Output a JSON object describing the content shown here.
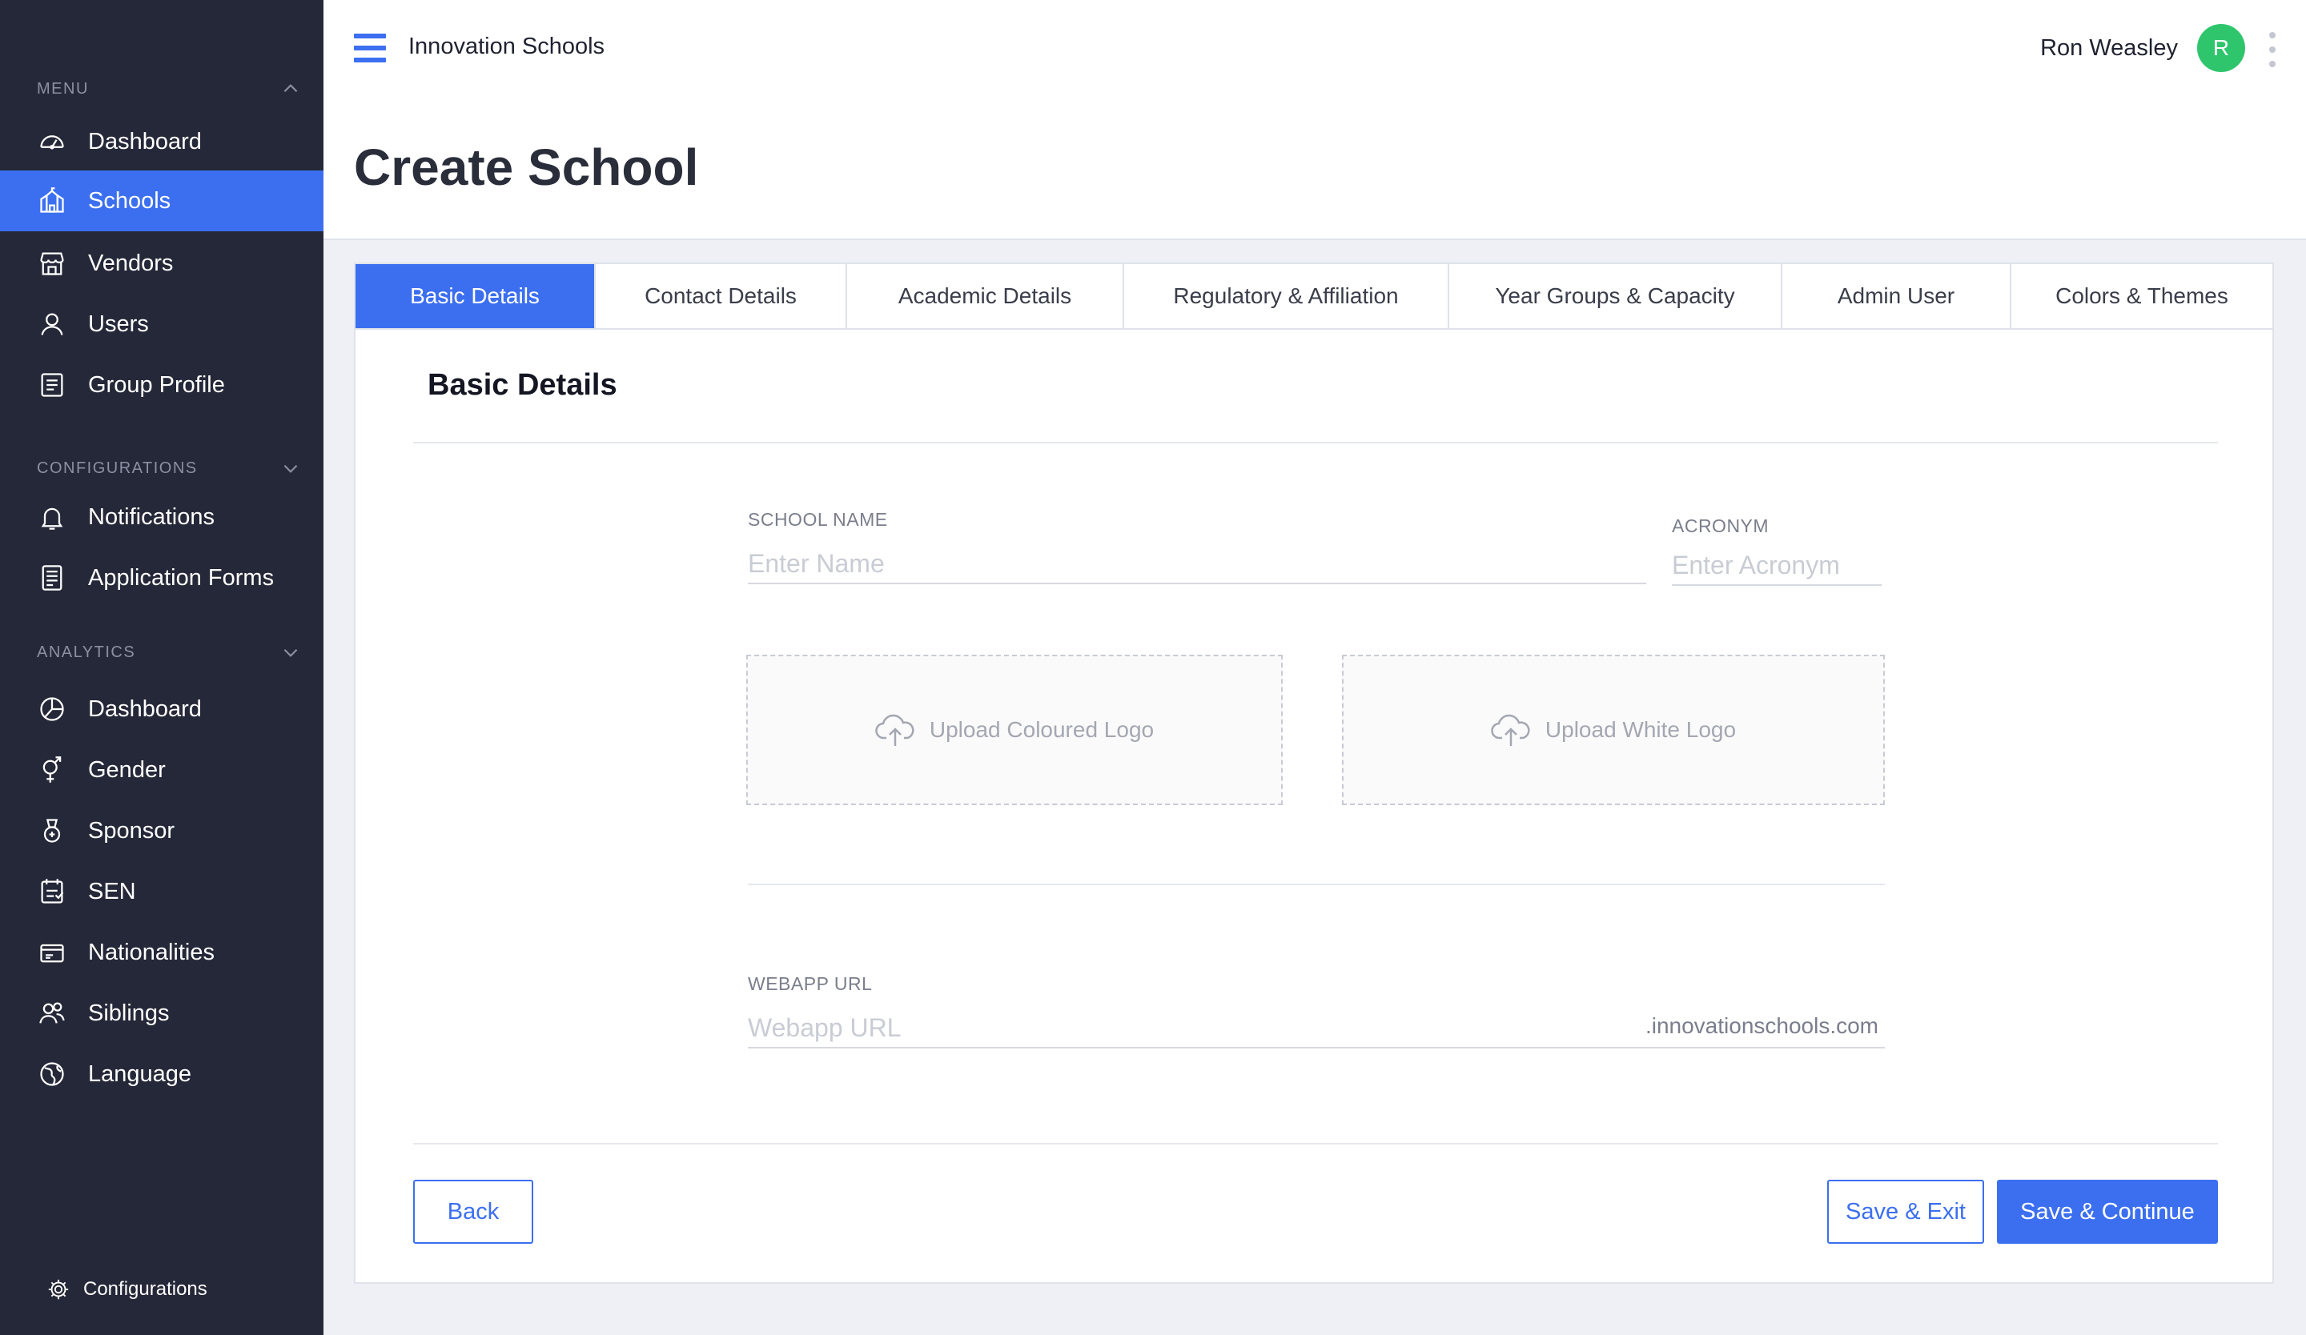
{
  "sidebar": {
    "menu_heading": "MENU",
    "menu_items": [
      {
        "label": "Dashboard",
        "icon": "dashboard-icon"
      },
      {
        "label": "Schools",
        "icon": "school-icon",
        "active": true
      },
      {
        "label": "Vendors",
        "icon": "store-icon"
      },
      {
        "label": "Users",
        "icon": "user-icon"
      },
      {
        "label": "Group Profile",
        "icon": "profile-icon"
      }
    ],
    "config_heading": "CONFIGURATIONS",
    "config_items": [
      {
        "label": "Notifications",
        "icon": "bell-icon"
      },
      {
        "label": "Application Forms",
        "icon": "form-icon"
      }
    ],
    "analytics_heading": "ANALYTICS",
    "analytics_items": [
      {
        "label": "Dashboard",
        "icon": "pie-chart-icon"
      },
      {
        "label": "Gender",
        "icon": "gender-icon"
      },
      {
        "label": "Sponsor",
        "icon": "sponsor-icon"
      },
      {
        "label": "SEN",
        "icon": "sen-icon"
      },
      {
        "label": "Nationalities",
        "icon": "passport-icon"
      },
      {
        "label": "Siblings",
        "icon": "siblings-icon"
      },
      {
        "label": "Language",
        "icon": "globe-icon"
      }
    ],
    "footer_label": "Configurations"
  },
  "header": {
    "org_name": "Innovation Schools",
    "page_title": "Create School",
    "user_name": "Ron Weasley",
    "avatar_initial": "R"
  },
  "tabs": [
    {
      "label": "Basic Details",
      "active": true
    },
    {
      "label": "Contact Details"
    },
    {
      "label": "Academic Details"
    },
    {
      "label": "Regulatory & Affiliation"
    },
    {
      "label": "Year Groups & Capacity"
    },
    {
      "label": "Admin User"
    },
    {
      "label": "Colors & Themes"
    }
  ],
  "form": {
    "section_title": "Basic Details",
    "school_name_label": "SCHOOL NAME",
    "school_name_placeholder": "Enter Name",
    "school_name_value": "",
    "acronym_label": "ACRONYM",
    "acronym_placeholder": "Enter Acronym",
    "acronym_value": "",
    "upload_coloured_logo": "Upload Coloured Logo",
    "upload_white_logo": "Upload White Logo",
    "webapp_url_label": "WEBAPP URL",
    "webapp_url_placeholder": "Webapp URL",
    "webapp_url_value": "",
    "webapp_url_suffix": ".innovationschools.com"
  },
  "actions": {
    "back": "Back",
    "save_exit": "Save & Exit",
    "save_continue": "Save & Continue"
  },
  "colors": {
    "sidebar_bg": "#252838",
    "accent": "#3c6ff0",
    "avatar": "#2fc56d"
  }
}
